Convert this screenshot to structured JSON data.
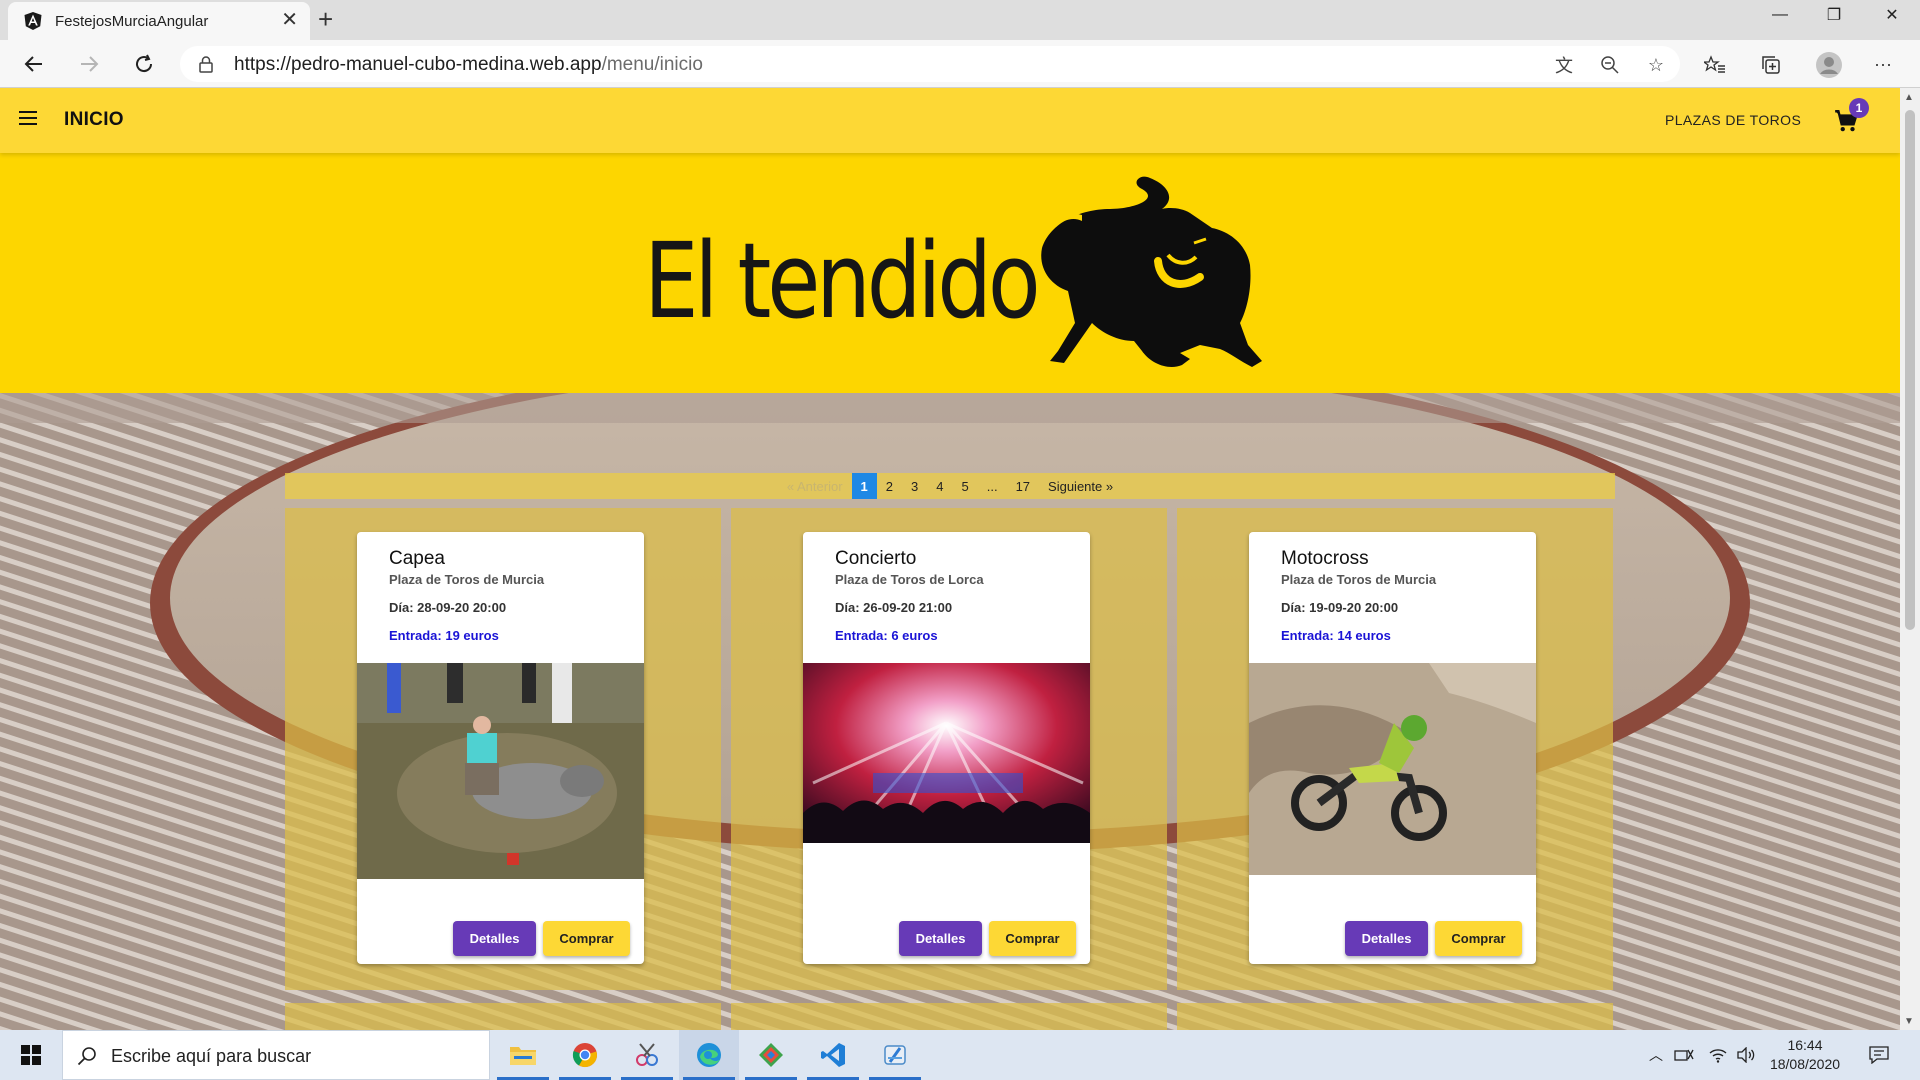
{
  "browser": {
    "tab_title": "FestejosMurciaAngular",
    "url_host": "https://pedro-manuel-cubo-medina.web.app",
    "url_path": "/menu/inicio"
  },
  "toolbar": {
    "title": "INICIO",
    "nav_link": "PLAZAS DE TOROS",
    "cart_count": "1"
  },
  "hero": {
    "text": "El tendido"
  },
  "pagination": {
    "prev": "« Anterior",
    "pages": [
      "1",
      "2",
      "3",
      "4",
      "5",
      "...",
      "17"
    ],
    "current": "1",
    "next": "Siguiente »"
  },
  "events": [
    {
      "title": "Capea",
      "place": "Plaza de Toros de Murcia",
      "date": "Día: 28-09-20 20:00",
      "price": "Entrada: 19 euros",
      "details_label": "Detalles",
      "buy_label": "Comprar"
    },
    {
      "title": "Concierto",
      "place": "Plaza de Toros de Lorca",
      "date": "Día: 26-09-20 21:00",
      "price": "Entrada: 6 euros",
      "details_label": "Detalles",
      "buy_label": "Comprar"
    },
    {
      "title": "Motocross",
      "place": "Plaza de Toros de Murcia",
      "date": "Día: 19-09-20 20:00",
      "price": "Entrada: 14 euros",
      "details_label": "Detalles",
      "buy_label": "Comprar"
    }
  ],
  "taskbar": {
    "search_placeholder": "Escribe aquí para buscar",
    "time": "16:44",
    "date": "18/08/2020"
  },
  "colors": {
    "toolbar": "#fdd835",
    "hero": "#fdd600",
    "primary_button": "#673ab7",
    "price_text": "#1a13d6",
    "current_page": "#1e88e5"
  }
}
